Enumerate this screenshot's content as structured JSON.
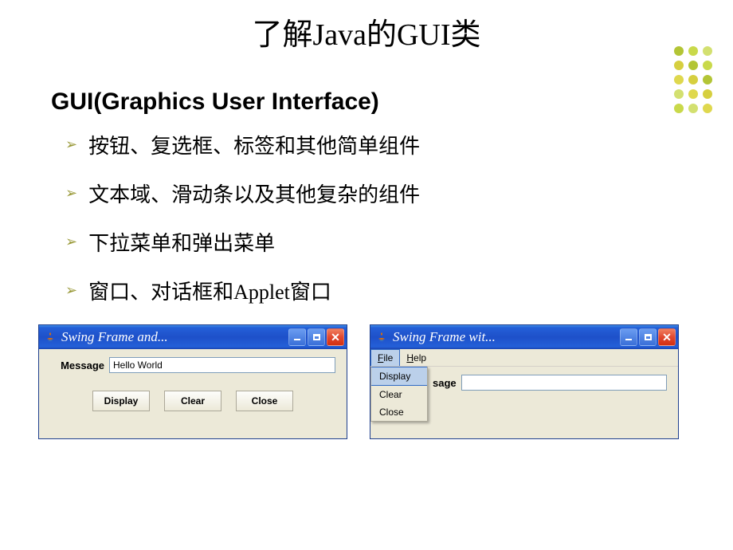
{
  "slide": {
    "title": "了解Java的GUI类",
    "subtitle": "GUI(Graphics User Interface)",
    "bullets": [
      "按钮、复选框、标签和其他简单组件",
      "文本域、滑动条以及其他复杂的组件",
      "下拉菜单和弹出菜单",
      "窗口、对话框和Applet窗口"
    ]
  },
  "window1": {
    "title": "Swing Frame and...",
    "label": "Message",
    "inputValue": "Hello World",
    "buttons": {
      "display": "Display",
      "clear": "Clear",
      "close": "Close"
    }
  },
  "window2": {
    "title": "Swing Frame wit...",
    "menu": {
      "file": "F",
      "fileRest": "ile",
      "help": "H",
      "helpRest": "elp"
    },
    "dropdown": [
      "Display",
      "Clear",
      "Close"
    ],
    "partialLabel": "sage",
    "inputValue": ""
  }
}
